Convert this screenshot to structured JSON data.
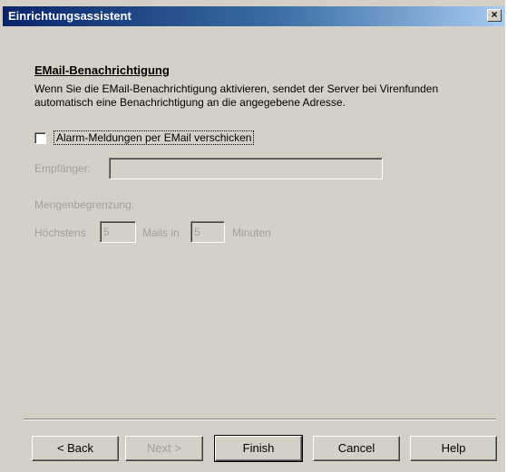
{
  "window": {
    "title": "Einrichtungsassistent",
    "close_glyph": "×"
  },
  "section": {
    "heading": "EMail-Benachrichtigung",
    "description": "Wenn Sie die EMail-Benachrichtigung aktivieren, sendet der Server bei Virenfunden automatisch eine Benachrichtigung an die angegebene Adresse."
  },
  "alarm_checkbox": {
    "label": "Alarm-Meldungen per EMail verschicken",
    "checked": false
  },
  "recipient": {
    "label": "Empfänger:",
    "value": ""
  },
  "limit": {
    "label": "Mengenbegrenzung:",
    "max_label": "Höchstens",
    "max_value": "5",
    "mails_label": "Mails in",
    "minutes_value": "5",
    "minutes_label": "Minuten"
  },
  "buttons": {
    "back": "< Back",
    "next": "Next >",
    "finish": "Finish",
    "cancel": "Cancel",
    "help": "Help"
  },
  "colors": {
    "dialog_face": "#d4d0c8",
    "title_gradient_start": "#0a246a",
    "title_gradient_end": "#a6caf0",
    "disabled_text": "#a0a0a0"
  }
}
